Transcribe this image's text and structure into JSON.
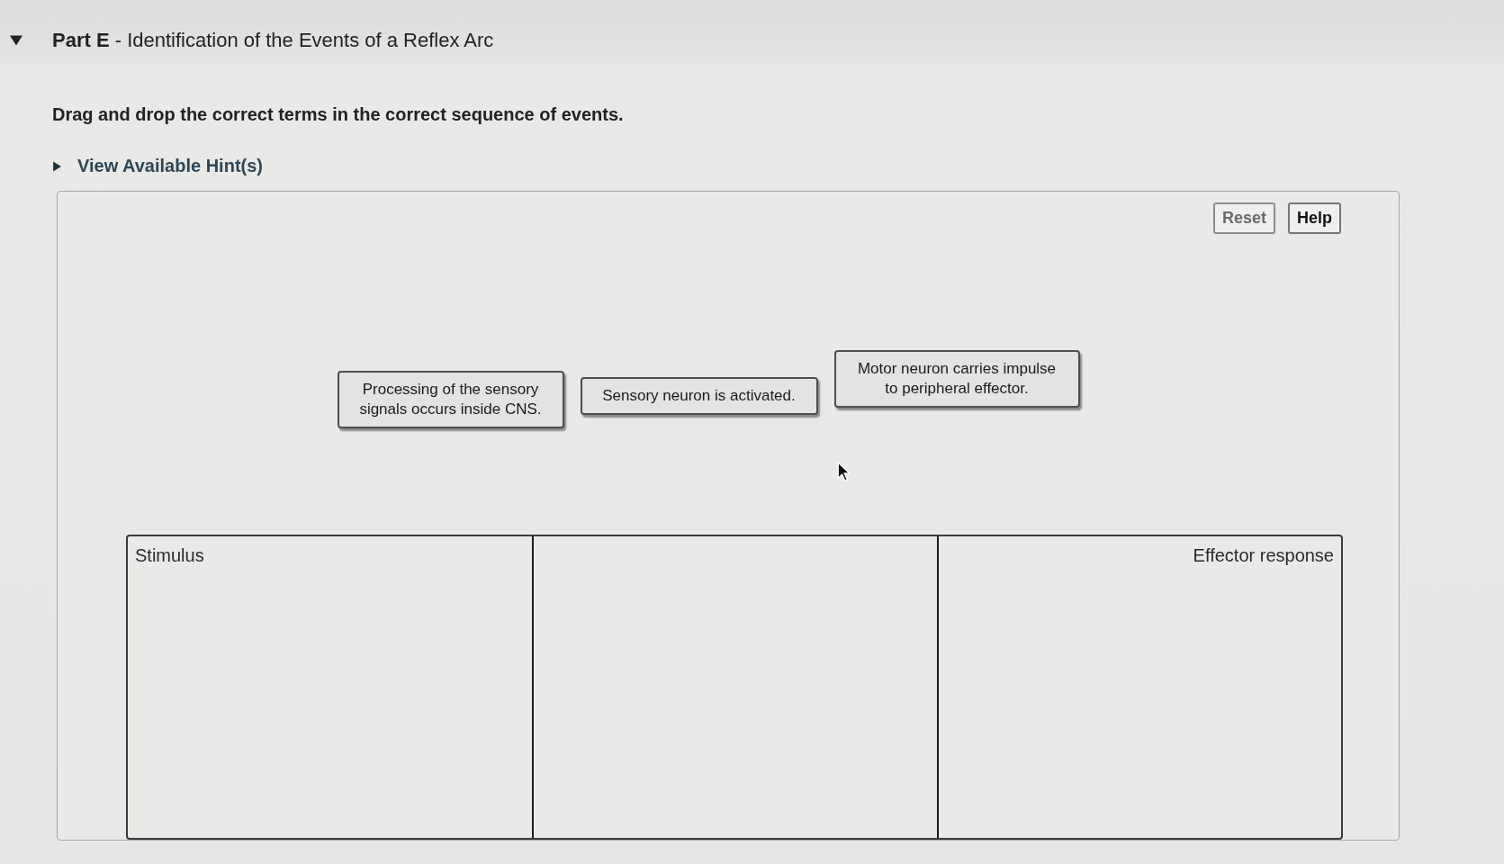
{
  "part": {
    "title": "**Part E** - Identification of the Events of a Reflex Arc",
    "expanded": true
  },
  "instruction": "Drag and drop the correct terms in the correct sequence of events.",
  "hints": {
    "label": "View Available Hint(s)",
    "expanded": false
  },
  "buttons": [
    {
      "label": "Reset",
      "disabled": true
    },
    {
      "label": "Help",
      "disabled": false
    }
  ],
  "tiles": [
    {
      "label": "Processing of the sensory signals occurs inside CNS."
    },
    {
      "label": "Sensory neuron is activated."
    },
    {
      "label": "Motor neuron carries impulse to peripheral effector."
    }
  ],
  "drop_zones": [
    {
      "kind": "start",
      "label": "Stimulus"
    },
    {
      "kind": "blank"
    },
    {
      "kind": "end",
      "label": "Effector response"
    }
  ]
}
